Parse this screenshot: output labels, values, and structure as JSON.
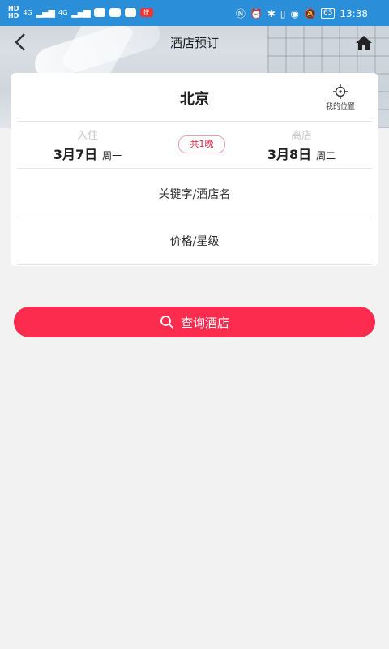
{
  "status_bar": {
    "hd1": "HD",
    "hd2": "HD",
    "net1": "4G",
    "net2": "4G",
    "battery": "63",
    "time": "13:38",
    "badge": "拼"
  },
  "header": {
    "title": "酒店预订"
  },
  "search_card": {
    "city": "北京",
    "location_label": "我的位置",
    "checkin_label": "入住",
    "checkin_date": "3月7日",
    "checkin_weekday": "周一",
    "nights": "共1晚",
    "checkout_label": "离店",
    "checkout_date": "3月8日",
    "checkout_weekday": "周二",
    "keyword_placeholder": "关键字/酒店名",
    "price_star_label": "价格/星级"
  },
  "search_button": {
    "label": "查询酒店"
  },
  "colors": {
    "status_bar": "#2a8fd8",
    "accent": "#fb2c4d",
    "background": "#f2f2f2"
  }
}
